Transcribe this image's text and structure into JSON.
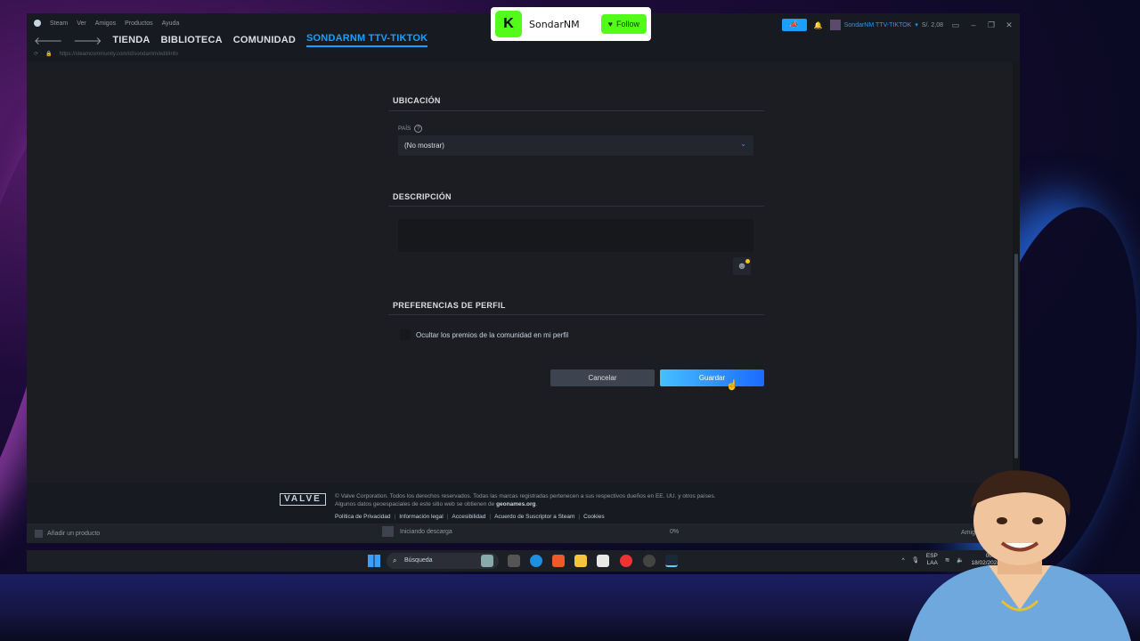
{
  "steam": {
    "menu": [
      "Steam",
      "Ver",
      "Amigos",
      "Productos",
      "Ayuda"
    ],
    "nav": {
      "store": "TIENDA",
      "library": "BIBLIOTECA",
      "community": "COMUNIDAD",
      "profile": "SONDARNM TTV-TIKTOK"
    },
    "url": "https://steamcommunity.com/id/sondarnm/edit/info",
    "user": {
      "name": "SondarNM TTV-TIKTOK",
      "balance": "S/. 2,08"
    }
  },
  "location": {
    "title": "UBICACIÓN",
    "country_label": "PAÍS",
    "country_value": "(No mostrar)"
  },
  "description": {
    "title": "DESCRIPCIÓN",
    "text": ""
  },
  "profile_prefs": {
    "title": "PREFERENCIAS DE PERFIL",
    "hide_awards_label": "Ocultar los premios de la comunidad en mi perfil",
    "hide_awards_checked": false
  },
  "buttons": {
    "cancel": "Cancelar",
    "save": "Guardar"
  },
  "footer": {
    "valve": "VALVE",
    "copyright": "© Valve Corporation. Todos los derechos reservados. Todas las marcas registradas pertenecen a sus respectivos dueños en EE. UU. y otros países.",
    "geo_prefix": "Algunos datos geoespaciales de este sitio web se obtienen de",
    "geo_link": "geonames.org",
    "links": [
      "Política de Privacidad",
      "Información legal",
      "Accesibilidad",
      "Acuerdo de Suscriptor a Steam",
      "Cookies"
    ]
  },
  "statusbar": {
    "add_product": "Añadir un producto",
    "download_status": "Iniciando descarga",
    "download_percent": "0%",
    "friends": "Amigos y chat"
  },
  "taskbar": {
    "search": "Búsqueda",
    "lang": "ESP",
    "lang2": "LAA",
    "time": "00:25",
    "date": "18/02/2024"
  },
  "kick": {
    "channel": "SondarNM",
    "follow": "Follow"
  }
}
